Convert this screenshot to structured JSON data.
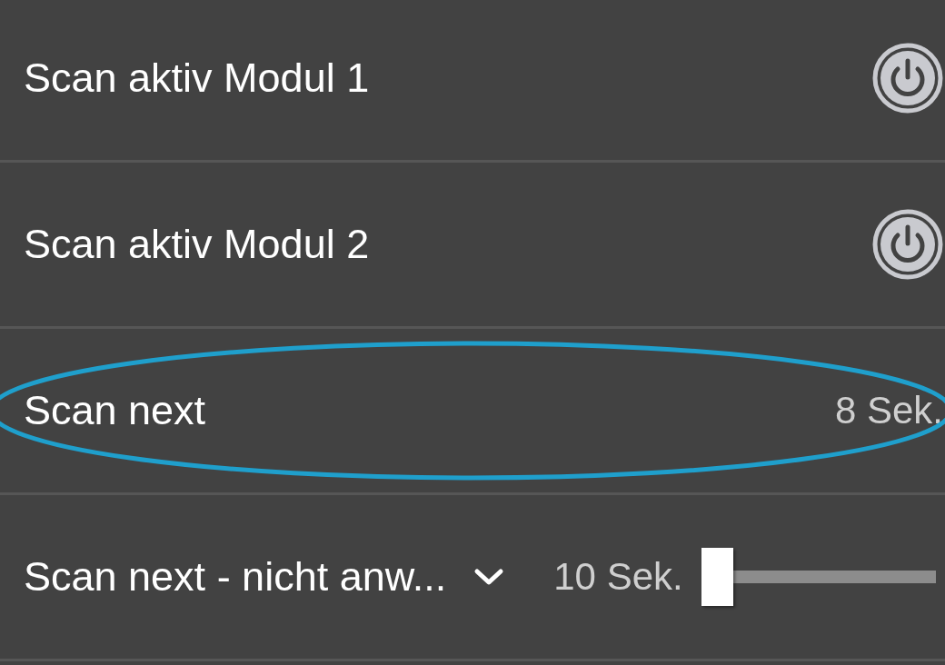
{
  "rows": [
    {
      "kind": "toggle",
      "label": "Scan aktiv Modul 1",
      "on": false,
      "highlighted": false
    },
    {
      "kind": "toggle",
      "label": "Scan aktiv Modul 2",
      "on": false,
      "highlighted": false
    },
    {
      "kind": "value",
      "label": "Scan next",
      "value": "8 Sek.",
      "highlighted": true
    },
    {
      "kind": "slider",
      "label": "Scan next - nicht anw...",
      "value": "10 Sek.",
      "level": 0,
      "expanded": false,
      "highlighted": false
    }
  ]
}
